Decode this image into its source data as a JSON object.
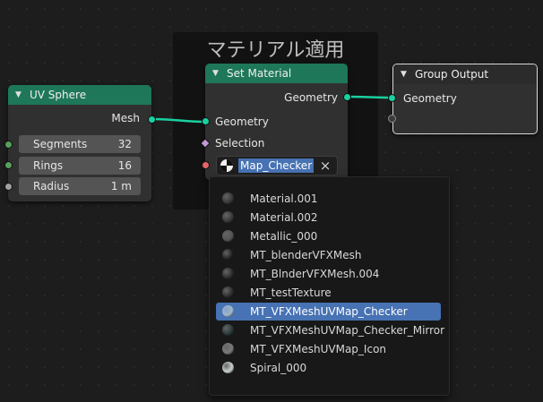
{
  "frame": {
    "label": "マテリアル適用"
  },
  "uv_sphere": {
    "title": "UV Sphere",
    "output": "Mesh",
    "fields": [
      {
        "label": "Segments",
        "value": "32"
      },
      {
        "label": "Rings",
        "value": "16"
      },
      {
        "label": "Radius",
        "value": "1 m"
      }
    ]
  },
  "set_material": {
    "title": "Set Material",
    "output": "Geometry",
    "inputs": {
      "geometry": "Geometry",
      "selection": "Selection"
    },
    "material_value": "Map_Checker",
    "clear_icon": "×"
  },
  "group_output": {
    "title": "Group Output",
    "input": "Geometry"
  },
  "dropdown": {
    "items": [
      {
        "label": "Material.001",
        "ball": "#3a3a3a",
        "selected": false
      },
      {
        "label": "Material.002",
        "ball": "#3a3a3a",
        "selected": false
      },
      {
        "label": "Metallic_000",
        "ball": "#555555",
        "selected": false
      },
      {
        "label": "MT_blenderVFXMesh",
        "ball": "#222222",
        "selected": false
      },
      {
        "label": "MT_BlnderVFXMesh.004",
        "ball": "#2e2e2e",
        "selected": false
      },
      {
        "label": "MT_testTexture",
        "ball": "#2e2e2e",
        "selected": false
      },
      {
        "label": "MT_VFXMeshUVMap_Checker",
        "ball": "#9fb8c8",
        "selected": true
      },
      {
        "label": "MT_VFXMeshUVMap_Checker_Mirror",
        "ball": "#2b3a3a",
        "selected": false
      },
      {
        "label": "MT_VFXMeshUVMap_Icon",
        "ball": "#7a7a7a",
        "selected": false
      },
      {
        "label": "Spiral_000",
        "ball": "#c8d0d0",
        "selected": false
      }
    ]
  },
  "colors": {
    "geometry_link": "#19d0a1",
    "node_header_green": "#1e7759",
    "selection_blue": "#4772b3"
  }
}
